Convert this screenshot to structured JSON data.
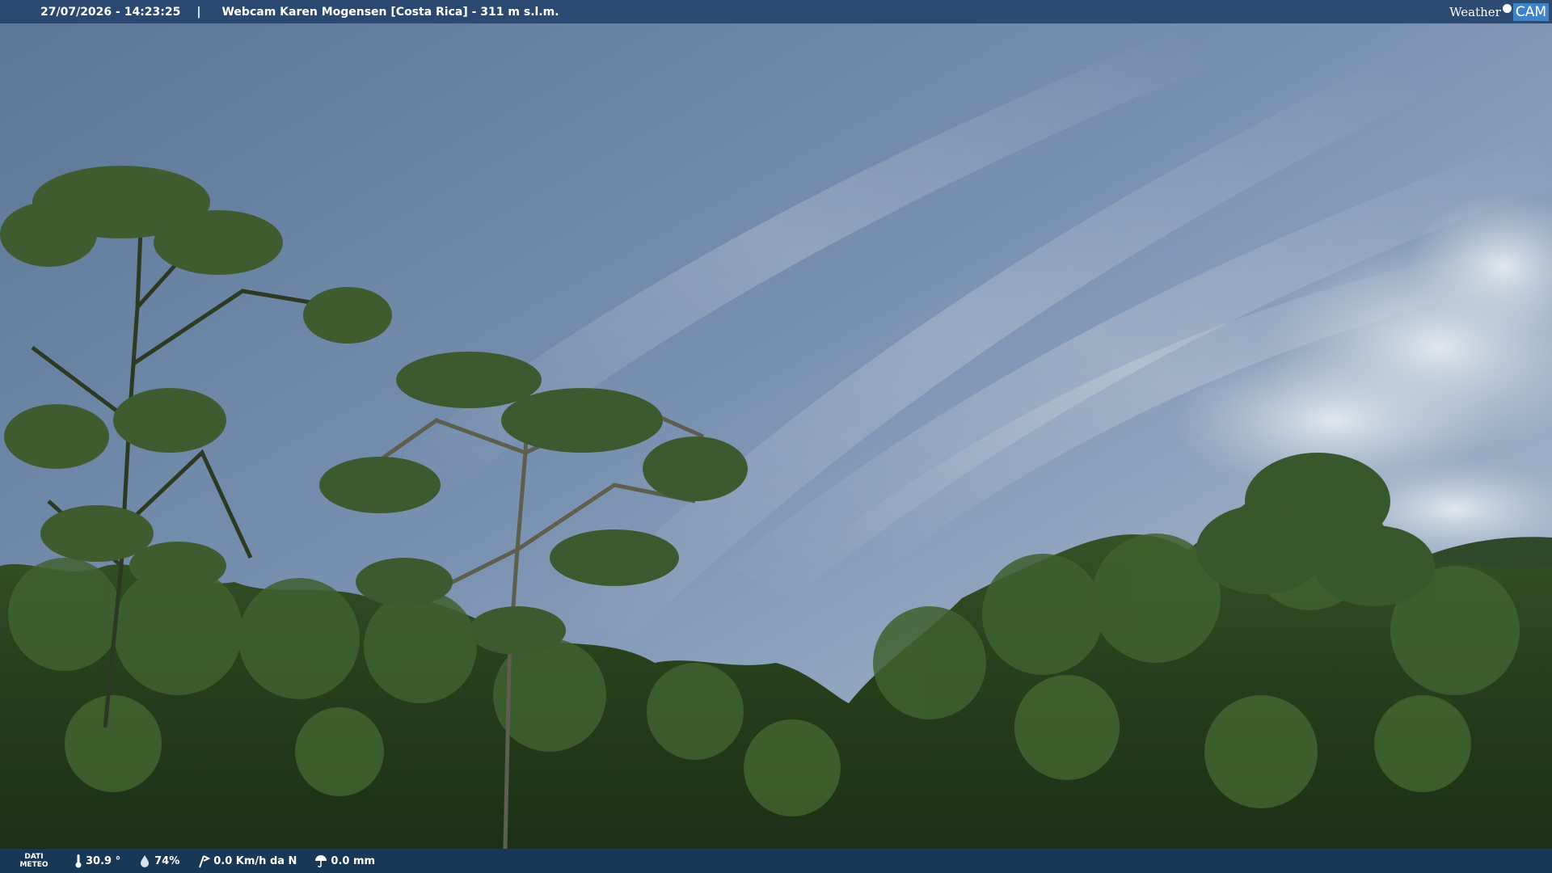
{
  "header": {
    "timestamp": "27/07/2026 - 14:23:25",
    "separator": "|",
    "title": "Webcam Karen Mogensen [Costa Rica] - 311 m s.l.m."
  },
  "logo": {
    "word_1": "Weather",
    "word_2": "CAM"
  },
  "weather": {
    "label_line_1": "DATI",
    "label_line_2": "METEO",
    "temperature": "30.9 °",
    "humidity": "74%",
    "wind": "0.0 Km/h da N",
    "rain": "0.0 mm"
  },
  "colors": {
    "top_bar": "#26446c",
    "bottom_bar": "#183a5c",
    "logo_accent": "#3d83c9",
    "sky": "#7d95b2",
    "foliage": "#2e4a22"
  }
}
